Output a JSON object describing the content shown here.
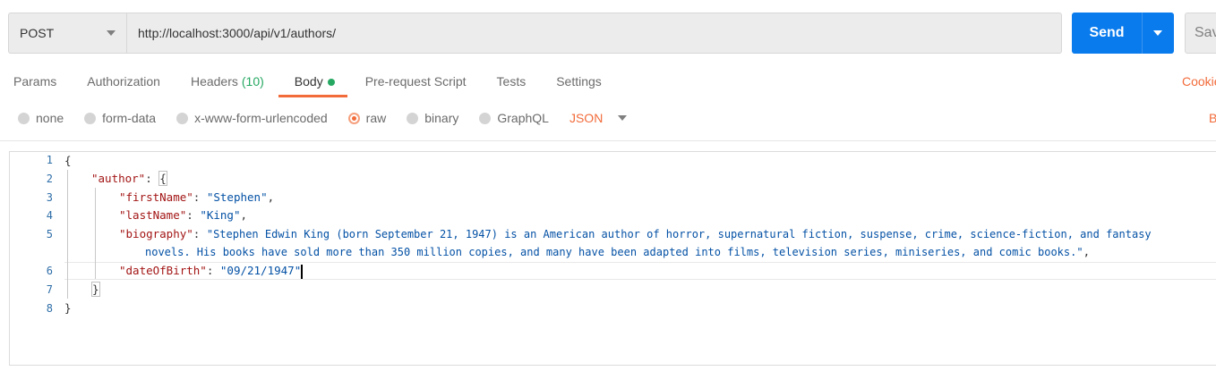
{
  "request": {
    "method": "POST",
    "url": "http://localhost:3000/api/v1/authors/",
    "send_label": "Send",
    "save_label": "Save"
  },
  "tabs": [
    {
      "label": "Params"
    },
    {
      "label": "Authorization"
    },
    {
      "label": "Headers",
      "count": "(10)"
    },
    {
      "label": "Body",
      "active": true
    },
    {
      "label": "Pre-request Script"
    },
    {
      "label": "Tests"
    },
    {
      "label": "Settings"
    }
  ],
  "cookies_label": "Cookies",
  "body_types": [
    {
      "label": "none"
    },
    {
      "label": "form-data"
    },
    {
      "label": "x-www-form-urlencoded"
    },
    {
      "label": "raw",
      "selected": true
    },
    {
      "label": "binary"
    },
    {
      "label": "GraphQL"
    }
  ],
  "body_language": "JSON",
  "beautify_label": "Beautify",
  "editor": {
    "line_numbers": [
      "1",
      "2",
      "3",
      "4",
      "5",
      "6",
      "7",
      "8"
    ],
    "lines": {
      "l1": "{",
      "l2_key": "\"author\"",
      "l2_rest": ": ",
      "l2_brace": "{",
      "l3_key": "\"firstName\"",
      "l3_val": "\"Stephen\"",
      "l4_key": "\"lastName\"",
      "l4_val": "\"King\"",
      "l5_key": "\"biography\"",
      "l5_val_a": "\"Stephen Edwin King (born September 21, 1947) is an American author of horror, supernatural fiction, suspense, crime, science-fiction, and fantasy",
      "l5_val_b": "novels. His books have sold more than 350 million copies, and many have been adapted into films, television series, miniseries, and comic books.\"",
      "l6_key": "\"dateOfBirth\"",
      "l6_val": "\"09/21/1947\"",
      "l7": "}",
      "l8": "}"
    }
  },
  "colors": {
    "accent": "#f26b3a",
    "send_button": "#097bed",
    "json_key": "#a31515",
    "json_string": "#0451a5",
    "success": "#26a862"
  }
}
